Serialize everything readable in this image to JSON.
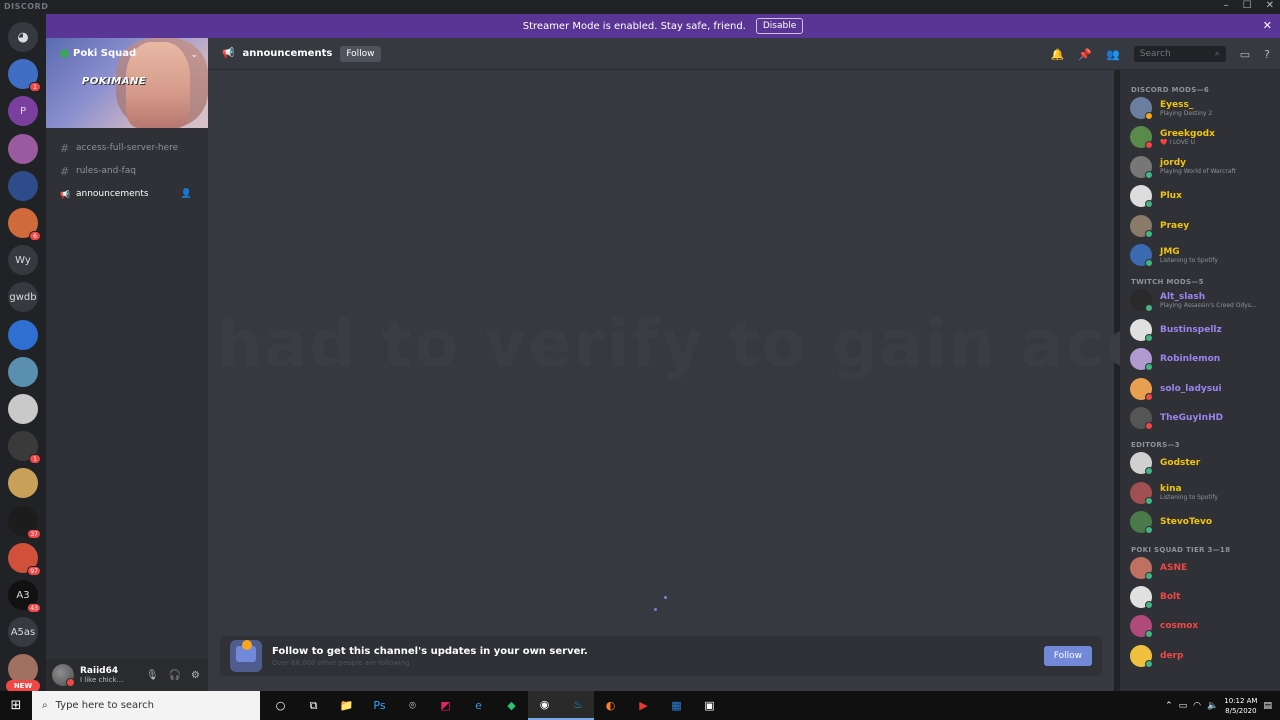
{
  "window": {
    "app_name": "DISCORD",
    "minimize": "–",
    "maximize": "☐",
    "close": "✕"
  },
  "streamer_bar": {
    "message": "Streamer Mode is enabled. Stay safe, friend.",
    "disable_label": "Disable",
    "close": "✕"
  },
  "guilds": [
    {
      "label": "",
      "icon": "discord-home-icon",
      "color": "#36393f",
      "badge": ""
    },
    {
      "label": "",
      "icon": "server-icon",
      "color": "#3f6ec4",
      "badge": "1"
    },
    {
      "label": "P",
      "icon": "server-icon",
      "color": "#7b3fa0",
      "badge": ""
    },
    {
      "label": "",
      "icon": "server-icon",
      "color": "#9a5aa0",
      "badge": ""
    },
    {
      "label": "",
      "icon": "server-icon",
      "color": "#2e4c8a",
      "badge": ""
    },
    {
      "label": "",
      "icon": "server-icon",
      "color": "#d06a3a",
      "badge": "6"
    },
    {
      "label": "Wy",
      "icon": "server-icon",
      "color": "#36393f",
      "badge": ""
    },
    {
      "label": "gwdb",
      "icon": "server-icon",
      "color": "#36393f",
      "badge": ""
    },
    {
      "label": "",
      "icon": "server-icon",
      "color": "#2f6fd1",
      "badge": ""
    },
    {
      "label": "",
      "icon": "server-icon",
      "color": "#5a8fb0",
      "badge": ""
    },
    {
      "label": "",
      "icon": "server-icon",
      "color": "#c9c9c9",
      "badge": ""
    },
    {
      "label": "",
      "icon": "server-icon",
      "color": "#3a3a3a",
      "badge": "1"
    },
    {
      "label": "",
      "icon": "server-icon",
      "color": "#c9a05a",
      "badge": ""
    },
    {
      "label": "",
      "icon": "server-icon",
      "color": "#1c1c1c",
      "badge": "37"
    },
    {
      "label": "",
      "icon": "server-icon",
      "color": "#d0503a",
      "badge": "97"
    },
    {
      "label": "A3",
      "icon": "server-icon",
      "color": "#111111",
      "badge": "43"
    },
    {
      "label": "A5as",
      "icon": "server-icon",
      "color": "#36393f",
      "badge": ""
    },
    {
      "label": "",
      "icon": "server-icon",
      "color": "#a07060",
      "badge": ""
    }
  ],
  "new_tag": "NEW",
  "server": {
    "name": "Poki Squad",
    "banner_text": "POKIMANE",
    "chevron": "⌄"
  },
  "channels": [
    {
      "name": "access-full-server-here",
      "icon": "#"
    },
    {
      "name": "rules-and-faq",
      "icon": "#"
    },
    {
      "name": "announcements",
      "icon": "📢"
    }
  ],
  "user": {
    "name": "Raiid64",
    "status": "I like chick..."
  },
  "header": {
    "channel": "announcements",
    "follow_label": "Follow",
    "search_placeholder": "Search"
  },
  "watermark": "had to verify to gain access",
  "follow_banner": {
    "title": "Follow to get this channel's updates in your own server.",
    "subtitle": "Over 68,000 other people are following",
    "button": "Follow"
  },
  "member_groups": [
    {
      "header": "DISCORD MODS—6",
      "members": [
        {
          "name": "Eyess_",
          "activity": "Playing Destiny 2",
          "color": "#f1c40f",
          "status": "#faa61a",
          "avatar": "#6a7fa0"
        },
        {
          "name": "Greekgodx",
          "activity": "❤️ I LOVE U",
          "color": "#f1c40f",
          "status": "#f04747",
          "avatar": "#5a8a4a"
        },
        {
          "name": "jordy",
          "activity": "Playing World of Warcraft",
          "color": "#f1c40f",
          "status": "#43b581",
          "avatar": "#777777"
        },
        {
          "name": "Plux",
          "activity": "",
          "color": "#f1c40f",
          "status": "#43b581",
          "avatar": "#dddddd"
        },
        {
          "name": "Praey",
          "activity": "",
          "color": "#f1c40f",
          "status": "#43b581",
          "avatar": "#8a7a6a"
        },
        {
          "name": "JMG",
          "activity": "Listening to Spotify",
          "color": "#f1c40f",
          "status": "#43b581",
          "avatar": "#3a6ab0"
        }
      ]
    },
    {
      "header": "TWITCH MODS—5",
      "members": [
        {
          "name": "Alt_slash",
          "activity": "Playing Assassin's Creed Odys...",
          "color": "#9b84ee",
          "status": "#43b581",
          "avatar": "#2a2a2a"
        },
        {
          "name": "Bustinspellz",
          "activity": "",
          "color": "#9b84ee",
          "status": "#43b581",
          "avatar": "#e0e0e0"
        },
        {
          "name": "Robinlemon",
          "activity": "",
          "color": "#9b84ee",
          "status": "#43b581",
          "avatar": "#b09ad0"
        },
        {
          "name": "solo_ladysui",
          "activity": "",
          "color": "#9b84ee",
          "status": "#f04747",
          "avatar": "#e8a050"
        },
        {
          "name": "TheGuyInHD",
          "activity": "",
          "color": "#9b84ee",
          "status": "#f04747",
          "avatar": "#555555"
        }
      ]
    },
    {
      "header": "EDITORS—3",
      "members": [
        {
          "name": "Godster",
          "activity": "",
          "color": "#f1c40f",
          "status": "#43b581",
          "avatar": "#d0d0d0"
        },
        {
          "name": "kina",
          "activity": "Listening to Spotify",
          "color": "#f1c40f",
          "status": "#43b581",
          "avatar": "#a05050"
        },
        {
          "name": "StevoTevo",
          "activity": "",
          "color": "#f1c40f",
          "status": "#43b581",
          "avatar": "#4a7a4a"
        }
      ]
    },
    {
      "header": "POKI SQUAD TIER 3—18",
      "members": [
        {
          "name": "ASNE",
          "activity": "",
          "color": "#f04747",
          "status": "#43b581",
          "avatar": "#c07060"
        },
        {
          "name": "Bolt",
          "activity": "",
          "color": "#f04747",
          "status": "#43b581",
          "avatar": "#e0e0e0"
        },
        {
          "name": "cosmox",
          "activity": "",
          "color": "#f04747",
          "status": "#43b581",
          "avatar": "#b04a7a"
        },
        {
          "name": "derp",
          "activity": "",
          "color": "#f04747",
          "status": "#43b581",
          "avatar": "#f0c040"
        }
      ]
    }
  ],
  "taskbar": {
    "search_placeholder": "Type here to search",
    "apps": [
      "○",
      "⧉",
      "📁",
      "Ps",
      "⌾",
      "◩",
      "e",
      "◆",
      "◉",
      "♨",
      "◐",
      "▶",
      "▦",
      "▣"
    ],
    "time": "10:12 AM",
    "date": "8/5/2020"
  },
  "colors": {
    "accent": "#7289da",
    "streamer_bar": "#593695",
    "danger": "#f04747"
  }
}
